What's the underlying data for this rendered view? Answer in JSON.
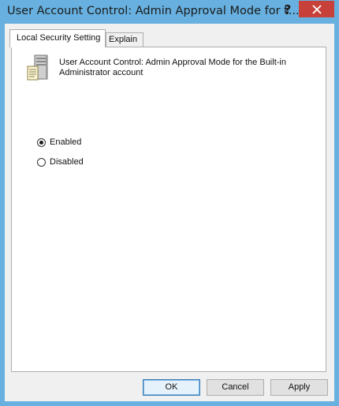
{
  "window": {
    "title": "User Account Control: Admin Approval Mode for t...",
    "help_label": "?",
    "close_icon": "close-icon"
  },
  "tabs": [
    {
      "label": "Local Security Setting",
      "active": true
    },
    {
      "label": "Explain",
      "active": false
    }
  ],
  "policy": {
    "icon": "server-policy-icon",
    "title": "User Account Control: Admin Approval Mode for the Built-in Administrator account"
  },
  "options": [
    {
      "label": "Enabled",
      "checked": true
    },
    {
      "label": "Disabled",
      "checked": false
    }
  ],
  "buttons": {
    "ok": "OK",
    "cancel": "Cancel",
    "apply": "Apply"
  },
  "colors": {
    "frame": "#67b0df",
    "close": "#c7413a",
    "client": "#f0f0f0"
  }
}
